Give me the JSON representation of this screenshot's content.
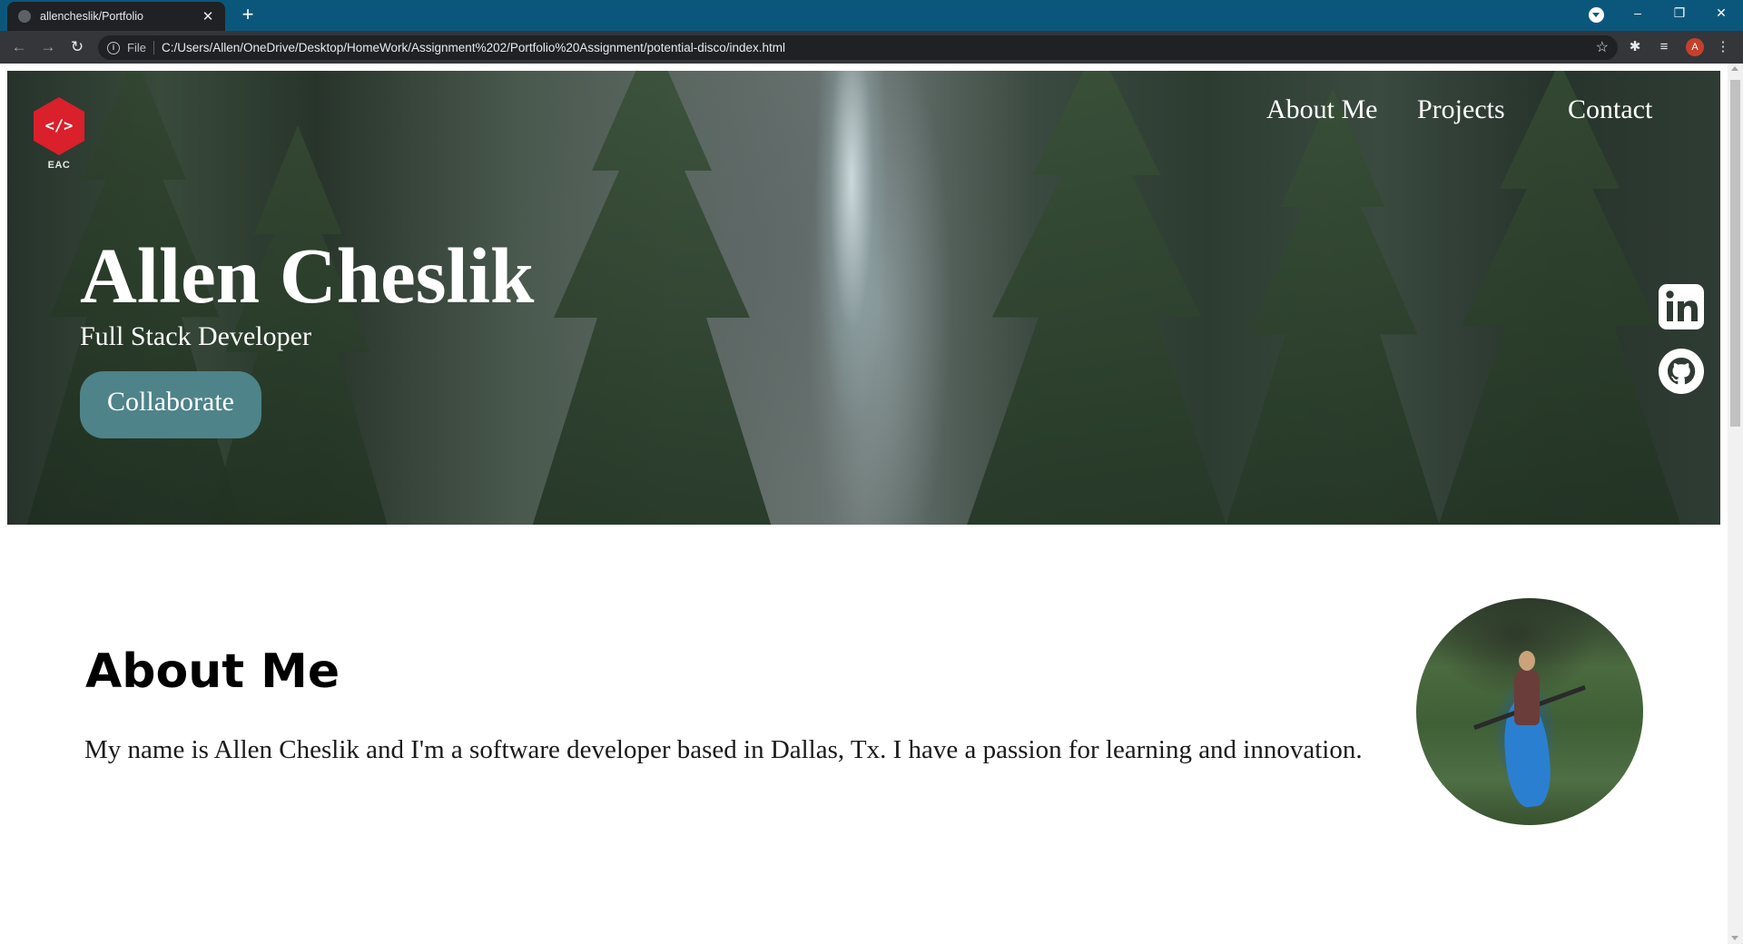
{
  "browser": {
    "tab_title": "allencheslik/Portfolio",
    "tab_close": "✕",
    "new_tab": "+",
    "window_controls": {
      "minimize": "–",
      "restore": "❐",
      "close": "✕"
    },
    "file_label": "File",
    "url": "C:/Users/Allen/OneDrive/Desktop/HomeWork/Assignment%202/Portfolio%20Assignment/potential-disco/index.html",
    "profile_initial": "A",
    "icons": [
      "back-icon",
      "forward-icon",
      "reload-icon",
      "info-icon",
      "star-icon",
      "extensions-icon",
      "reading-list-icon",
      "menu-icon"
    ]
  },
  "hero": {
    "logo_text": "EAC",
    "logo_glyph": "</>",
    "nav": [
      "About Me",
      "Projects",
      "Contact"
    ],
    "name": "Allen Cheslik",
    "role": "Full Stack Developer",
    "cta": "Collaborate",
    "social": [
      "linkedin-icon",
      "github-icon"
    ]
  },
  "about": {
    "title": "About Me",
    "text": "My name is Allen Cheslik and I'm a software developer based in Dallas, Tx. I have a passion for learning and innovation."
  },
  "colors": {
    "tabbar": "#0b577c",
    "logo_red": "#d9202b",
    "collab_button": "#4e8389"
  }
}
